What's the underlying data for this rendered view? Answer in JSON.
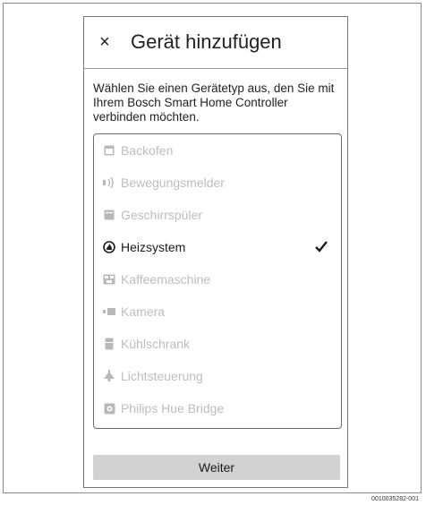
{
  "header": {
    "close_symbol": "×",
    "title": "Gerät hinzufügen"
  },
  "intro": "Wählen Sie einen Gerätetyp aus, den Sie mit Ihrem Bosch Smart Home Controller verbinden möchten.",
  "device_list": [
    {
      "label": "Backofen",
      "icon": "oven-icon",
      "selected": false
    },
    {
      "label": "Bewegungsmelder",
      "icon": "motion-sensor-icon",
      "selected": false
    },
    {
      "label": "Geschirrspüler",
      "icon": "dishwasher-icon",
      "selected": false
    },
    {
      "label": "Heizsystem",
      "icon": "heating-icon",
      "selected": true
    },
    {
      "label": "Kaffeemaschine",
      "icon": "coffee-machine-icon",
      "selected": false
    },
    {
      "label": "Kamera",
      "icon": "camera-icon",
      "selected": false
    },
    {
      "label": "Kühlschrank",
      "icon": "fridge-icon",
      "selected": false
    },
    {
      "label": "Lichtsteuerung",
      "icon": "light-control-icon",
      "selected": false
    },
    {
      "label": "Philips Hue Bridge",
      "icon": "hue-bridge-icon",
      "selected": false
    }
  ],
  "footer": {
    "continue_label": "Weiter"
  },
  "figure_code": "0010035282-001",
  "colors": {
    "disabled_text": "#bdbdbd",
    "button_bg": "#d2d2d2",
    "text": "#1a1a1a"
  }
}
